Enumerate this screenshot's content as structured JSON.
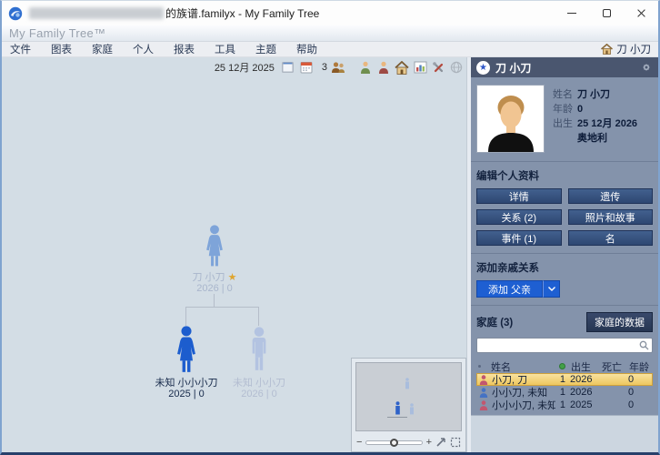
{
  "window": {
    "title": "的族谱.familyx - My Family Tree",
    "controls": {
      "minimize": "minimize",
      "maximize": "maximize",
      "close": "close"
    }
  },
  "brand": {
    "title": "My Family Tree™"
  },
  "menu": {
    "items": [
      "文件",
      "图表",
      "家庭",
      "个人",
      "报表",
      "工具",
      "主题",
      "帮助"
    ],
    "home_person": "刀 小刀"
  },
  "toolbar": {
    "date": "25 12月 2025",
    "count": "3",
    "icons": [
      "window-icon",
      "calendar-icon",
      "add-relatives-icon",
      "person-male-icon",
      "person-female-icon",
      "home-icon",
      "statistics-icon",
      "tools-icon",
      "web-icon"
    ]
  },
  "canvas": {
    "tree": {
      "root": {
        "name": "刀 小刀",
        "sub": "2026 | 0",
        "starred": true
      },
      "children": [
        {
          "name": "未知 小小小刀",
          "sub": "2025 | 0",
          "gender": "female"
        },
        {
          "name": "未知 小小刀",
          "sub": "2026 | 0",
          "gender": "male"
        }
      ]
    },
    "minimap": {
      "zoom_minus": "−",
      "zoom_plus": "+",
      "icons": [
        "fit-icon",
        "expand-icon"
      ]
    }
  },
  "sidebar": {
    "header": {
      "name": "刀 小刀",
      "icons": [
        "star-icon",
        "gear-icon"
      ]
    },
    "person": {
      "fields": [
        {
          "label": "姓名",
          "value": "刀 小刀"
        },
        {
          "label": "年龄",
          "value": "0"
        },
        {
          "label": "出生",
          "value": "25 12月 2026"
        },
        {
          "label": "",
          "value": "奥地利"
        }
      ]
    },
    "edit": {
      "title": "编辑个人资料",
      "buttons": [
        "详情",
        "遗传",
        "关系 (2)",
        "照片和故事",
        "事件 (1)",
        "名"
      ]
    },
    "add": {
      "title": "添加亲戚关系",
      "button": "添加 父亲"
    },
    "family": {
      "title": "家庭 (3)",
      "data_button": "家庭的数据",
      "search_value": "",
      "table": {
        "headers": {
          "name": "姓名",
          "born": "出生",
          "died": "死亡",
          "age": "年龄"
        },
        "rows": [
          {
            "name": "小刀, 刀",
            "count": "1",
            "born": "2026",
            "died": "",
            "age": "0",
            "gender": "female",
            "selected": true
          },
          {
            "name": "小小刀, 未知",
            "count": "1",
            "born": "2026",
            "died": "",
            "age": "0",
            "gender": "male",
            "selected": false
          },
          {
            "name": "小小小刀, 未知",
            "count": "1",
            "born": "2025",
            "died": "",
            "age": "0",
            "gender": "female",
            "selected": false
          }
        ]
      }
    }
  },
  "icons": {
    "star": "★"
  }
}
